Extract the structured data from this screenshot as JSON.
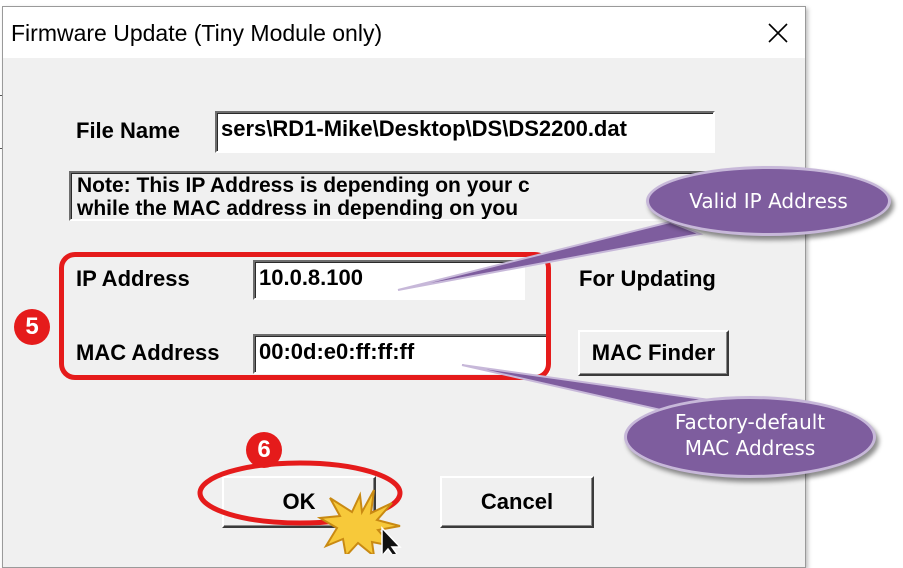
{
  "dialog": {
    "title": "Firmware Update (Tiny Module only)",
    "file_name_label": "File Name",
    "file_name_value": "sers\\RD1-Mike\\Desktop\\DS\\DS2200.dat",
    "note_line1": "Note: This IP Address is depending on your c",
    "note_line2": "while the  MAC address in depending on you",
    "ip_label": "IP Address",
    "ip_value": "10.0.8.100",
    "for_updating_label": "For Updating",
    "mac_label": "MAC Address",
    "mac_value": "00:0d:e0:ff:ff:ff",
    "mac_finder_button": "MAC Finder",
    "ok_button": "OK",
    "cancel_button": "Cancel"
  },
  "annotations": {
    "step5": "5",
    "step6": "6",
    "callout_ip": "Valid IP Address",
    "callout_mac_line1": "Factory-default",
    "callout_mac_line2": "MAC Address"
  },
  "colors": {
    "highlight_red": "#e51b1b",
    "callout_purple": "#7e5d9e",
    "dialog_bg": "#f0f0f0"
  },
  "icons": [
    "close-icon",
    "burst-icon",
    "mouse-pointer-icon"
  ]
}
